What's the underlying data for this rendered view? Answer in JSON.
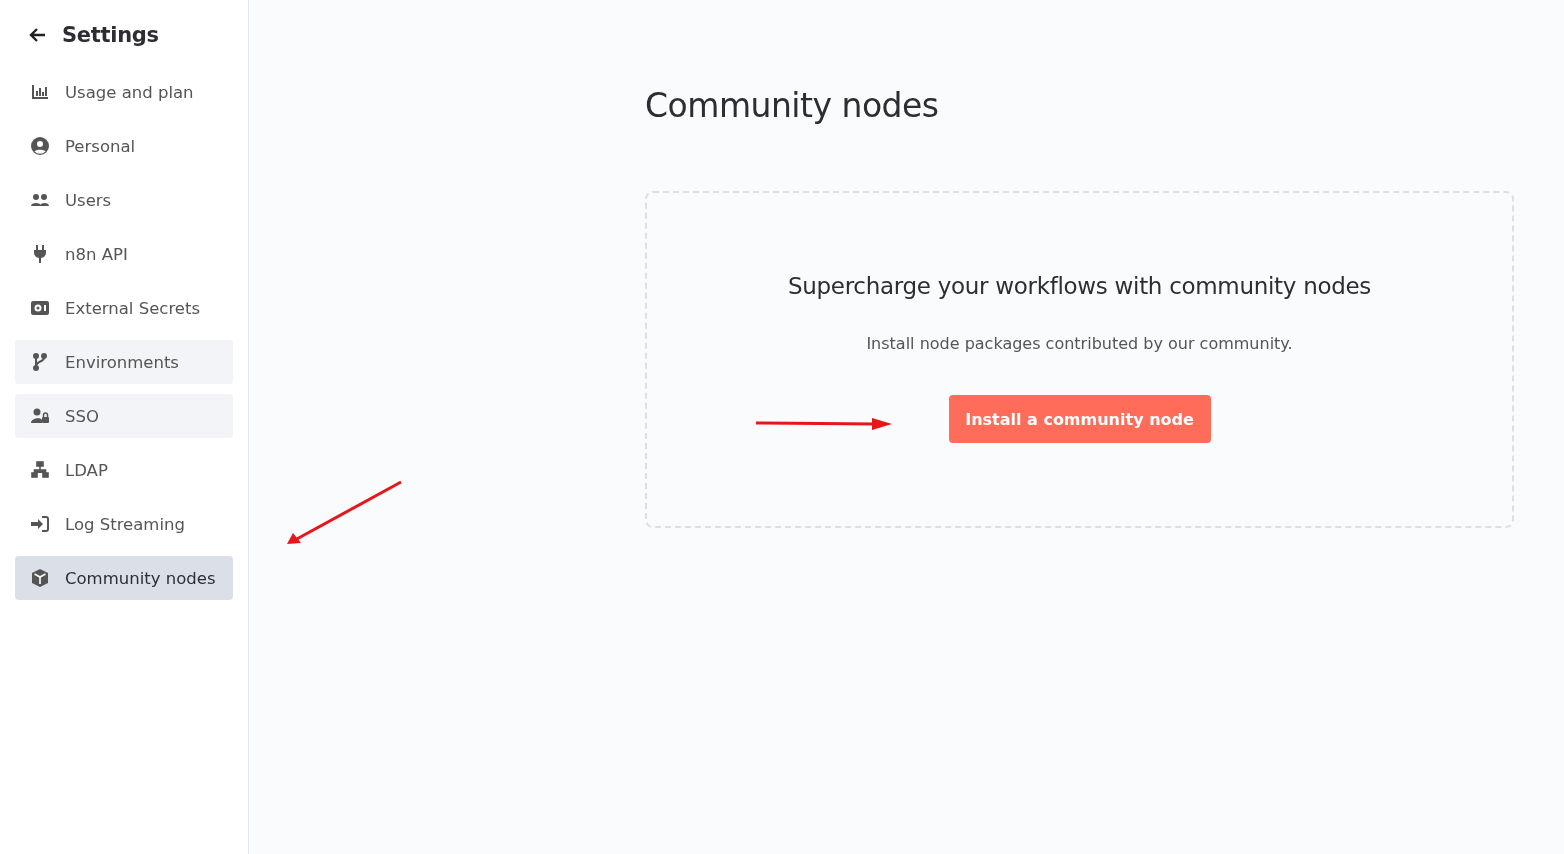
{
  "sidebar": {
    "back_label": "Settings",
    "items": [
      {
        "label": "Usage and plan",
        "selected": false,
        "highlighted": false
      },
      {
        "label": "Personal",
        "selected": false,
        "highlighted": false
      },
      {
        "label": "Users",
        "selected": false,
        "highlighted": false
      },
      {
        "label": "n8n API",
        "selected": false,
        "highlighted": false
      },
      {
        "label": "External Secrets",
        "selected": false,
        "highlighted": false
      },
      {
        "label": "Environments",
        "selected": false,
        "highlighted": true
      },
      {
        "label": "SSO",
        "selected": false,
        "highlighted": true
      },
      {
        "label": "LDAP",
        "selected": false,
        "highlighted": false
      },
      {
        "label": "Log Streaming",
        "selected": false,
        "highlighted": false
      },
      {
        "label": "Community nodes",
        "selected": true,
        "highlighted": false
      }
    ]
  },
  "main": {
    "title": "Community nodes",
    "empty_state": {
      "heading": "Supercharge your workflows with community nodes",
      "description": "Install node packages contributed by our community.",
      "button": "Install a community node"
    }
  }
}
